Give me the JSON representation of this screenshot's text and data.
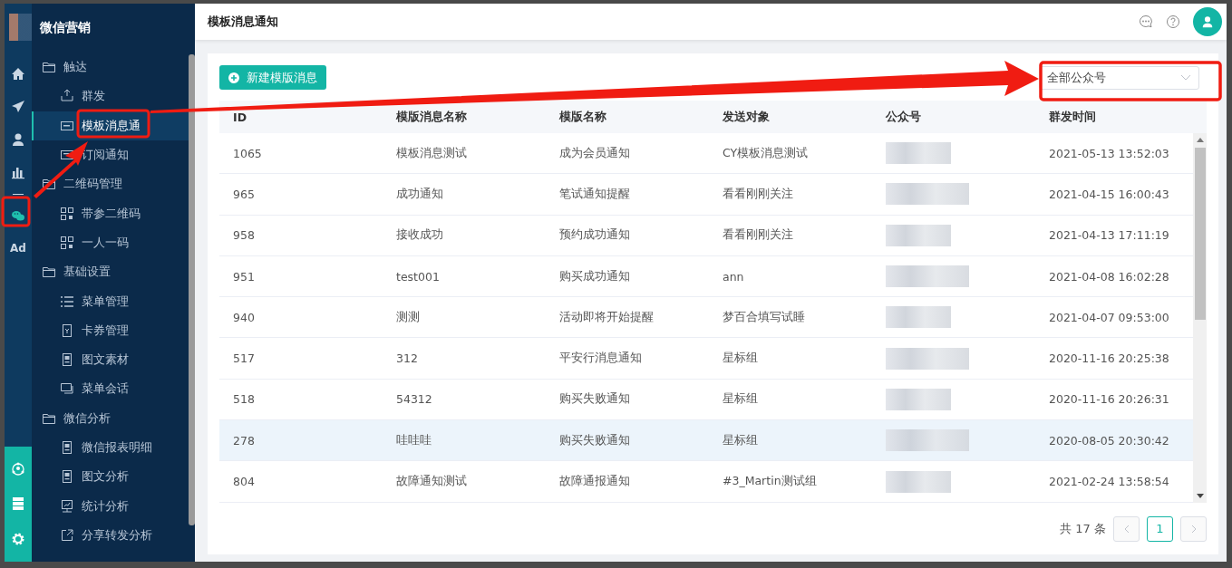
{
  "rail": {
    "items": [
      {
        "kind": "icon",
        "selected": false
      },
      {
        "kind": "icon",
        "selected": false
      },
      {
        "kind": "icon",
        "selected": false
      },
      {
        "kind": "icon",
        "selected": false
      },
      {
        "kind": "divider"
      },
      {
        "kind": "icon",
        "selected": true
      },
      {
        "kind": "text",
        "label": "Ad",
        "selected": false
      }
    ]
  },
  "sidebar": {
    "title": "微信营销",
    "groups": [
      {
        "label": "触达",
        "expanded": true,
        "children": [
          {
            "label": "群发",
            "selected": false
          },
          {
            "label": "模板消息通",
            "selected": true
          },
          {
            "label": "订阅通知",
            "selected": false
          }
        ]
      },
      {
        "label": "二维码管理",
        "expanded": true,
        "children": [
          {
            "label": "带参二维码",
            "selected": false
          },
          {
            "label": "一人一码",
            "selected": false
          }
        ]
      },
      {
        "label": "基础设置",
        "expanded": true,
        "children": [
          {
            "label": "菜单管理",
            "selected": false
          },
          {
            "label": "卡券管理",
            "selected": false
          },
          {
            "label": "图文素材",
            "selected": false
          },
          {
            "label": "菜单会话",
            "selected": false
          }
        ]
      },
      {
        "label": "微信分析",
        "expanded": true,
        "children": [
          {
            "label": "微信报表明细",
            "selected": false
          },
          {
            "label": "图文分析",
            "selected": false
          },
          {
            "label": "统计分析",
            "selected": false
          },
          {
            "label": "分享转发分析",
            "selected": false
          }
        ]
      }
    ]
  },
  "header": {
    "title": "模板消息通知"
  },
  "toolbar": {
    "new_button": "新建模版消息",
    "account_select": {
      "value": "全部公众号"
    }
  },
  "table": {
    "columns": [
      "ID",
      "模版消息名称",
      "模版名称",
      "发送对象",
      "公众号",
      "群发时间"
    ],
    "rows": [
      {
        "id": "1065",
        "message_name": "模板消息测试",
        "template_name": "成为会员通知",
        "recipient": "CY模板消息测试",
        "sent_time": "2021-05-13 13:52:03",
        "selected": false
      },
      {
        "id": "965",
        "message_name": "成功通知",
        "template_name": "笔试通知提醒",
        "recipient": "看看刚刚关注",
        "sent_time": "2021-04-15 16:00:43",
        "selected": false
      },
      {
        "id": "958",
        "message_name": "接收成功",
        "template_name": "预约成功通知",
        "recipient": "看看刚刚关注",
        "sent_time": "2021-04-13 17:11:19",
        "selected": false
      },
      {
        "id": "951",
        "message_name": "test001",
        "template_name": "购买成功通知",
        "recipient": "ann",
        "sent_time": "2021-04-08 16:02:28",
        "selected": false
      },
      {
        "id": "940",
        "message_name": "测测",
        "template_name": "活动即将开始提醒",
        "recipient": "梦百合填写试睡",
        "sent_time": "2021-04-07 09:53:00",
        "selected": false
      },
      {
        "id": "517",
        "message_name": "312",
        "template_name": "平安行消息通知",
        "recipient": "星标组",
        "sent_time": "2020-11-16 20:25:38",
        "selected": false
      },
      {
        "id": "518",
        "message_name": "54312",
        "template_name": "购买失败通知",
        "recipient": "星标组",
        "sent_time": "2020-11-16 20:26:31",
        "selected": false
      },
      {
        "id": "278",
        "message_name": "哇哇哇",
        "template_name": "购买失败通知",
        "recipient": "星标组",
        "sent_time": "2020-08-05 20:30:42",
        "selected": true
      },
      {
        "id": "804",
        "message_name": "故障通知测试",
        "template_name": "故障通报通知",
        "recipient": "#3_Martin测试组",
        "sent_time": "2021-02-24 13:58:54",
        "selected": false
      }
    ]
  },
  "pagination": {
    "total": "共 17 条",
    "prev_disabled": true,
    "next_disabled": true,
    "pages": [
      {
        "label": "1",
        "selected": true
      }
    ]
  }
}
